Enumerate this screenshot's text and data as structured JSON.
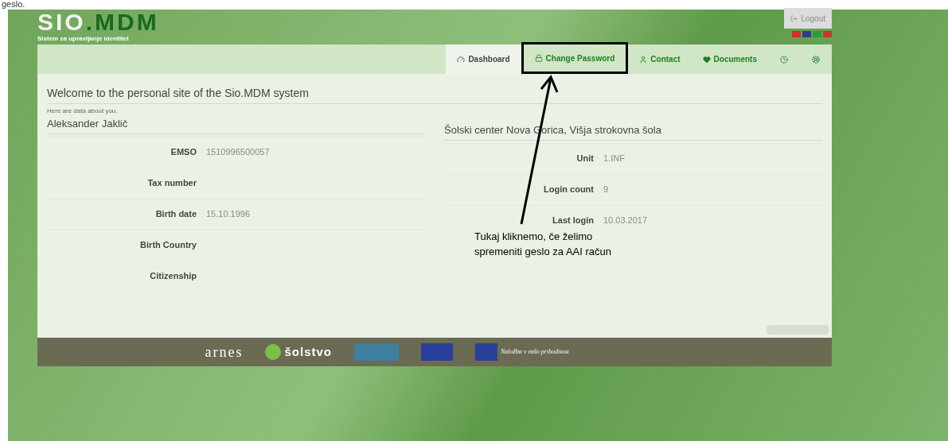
{
  "caption": "geslo.",
  "header": {
    "logo_left": "SIO",
    "logo_right": ".MDM",
    "subtitle": "Sistem za upravljanje identitet",
    "logout": "Logout"
  },
  "languages": [
    {
      "color": "#d42b2b"
    },
    {
      "color": "#2b3f8f"
    },
    {
      "color": "#2f9a3a"
    },
    {
      "color": "#c0392b"
    }
  ],
  "nav": [
    {
      "label": "Dashboard",
      "selected": true
    },
    {
      "label": "Change Password",
      "selected": false
    },
    {
      "label": "Contact",
      "selected": false
    },
    {
      "label": "Documents",
      "selected": false
    },
    {
      "selected": false
    },
    {
      "selected": false
    }
  ],
  "welcome": "Welcome to the personal site of the Sio.MDM system",
  "intro": "Here are data about you.",
  "person": {
    "name": "Aleksander Jaklič",
    "fields": [
      {
        "label": "EMSO",
        "value": "1510996500057"
      },
      {
        "label": "Tax number"
      },
      {
        "label": "Birth date",
        "value": "15.10.1996"
      },
      {
        "label": "Birth Country"
      },
      {
        "label": "Citizenship"
      }
    ]
  },
  "school": {
    "name": "Šolski center Nova Gorica, Višja strokovna šola",
    "fields": [
      {
        "label": "Unit",
        "value": "1.INF"
      },
      {
        "label": "Login count",
        "value": "9"
      },
      {
        "label": "Last login",
        "value": "10.03.2017"
      }
    ]
  },
  "footer": {
    "arnes": "arnes",
    "solstvo": "šolstvo",
    "eu_slogan": "Naložba v vašo prihodnost"
  },
  "annotation": "Tukaj kliknemo, če želimo spremeniti geslo za AAI račun"
}
